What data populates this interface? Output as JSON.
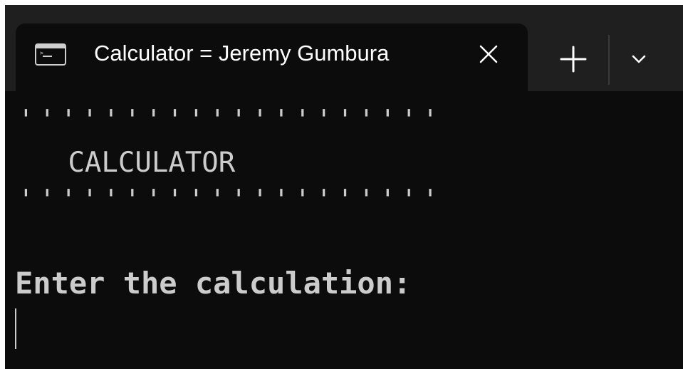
{
  "window": {
    "background_color": "#0c0c0c",
    "titlebar_color": "#1f1f1f",
    "text_color": "#cccccc"
  },
  "tab": {
    "title": "Calculator = Jeremy Gumbura",
    "icon": "terminal-icon",
    "close_icon": "close-icon"
  },
  "titlebar_controls": {
    "new_tab_icon": "plus-icon",
    "dropdown_icon": "chevron-down-icon"
  },
  "terminal": {
    "border_top": "''''''''''''''''''''",
    "banner": "   CALCULATOR",
    "border_bottom": "''''''''''''''''''''",
    "prompt": "Enter the calculation:"
  }
}
